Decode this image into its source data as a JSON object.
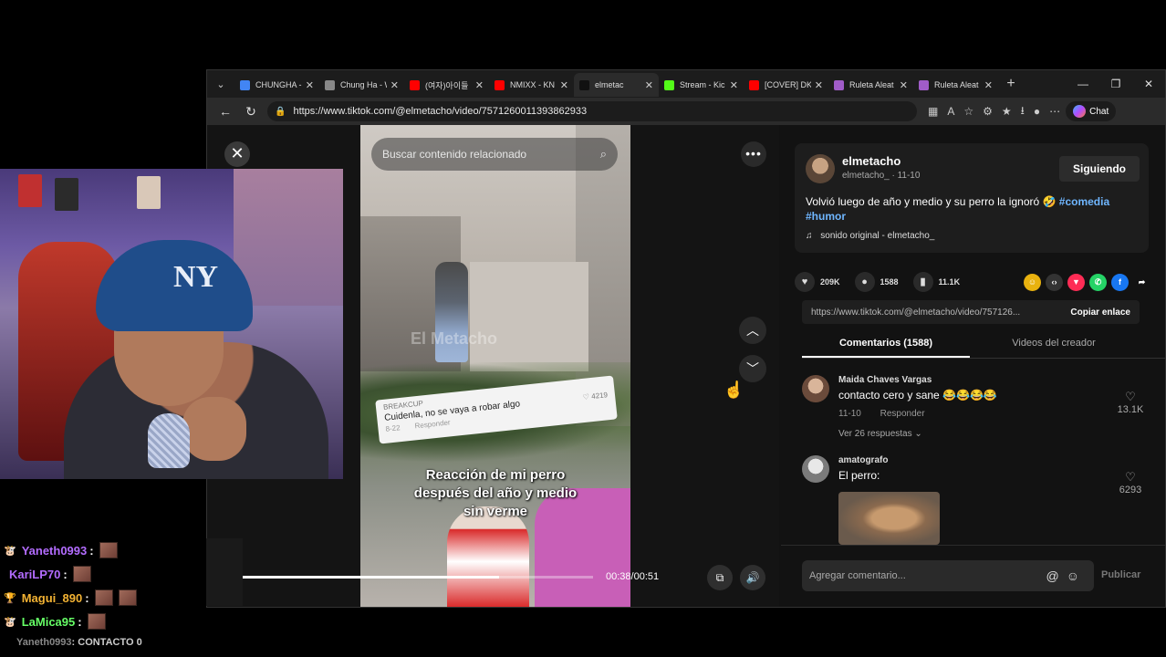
{
  "browser": {
    "tabs": [
      {
        "title": "CHUNGHA -",
        "color": "#4285f4",
        "active": false
      },
      {
        "title": "Chung Ha - W",
        "color": "#888888",
        "active": false
      },
      {
        "title": "(여자)아이들",
        "color": "#ff0000",
        "active": false
      },
      {
        "title": "NMIXX - KN",
        "color": "#ff0000",
        "active": false
      },
      {
        "title": "elmetac",
        "color": "#111111",
        "active": true
      },
      {
        "title": "Stream - Kic",
        "color": "#53fc18",
        "active": false
      },
      {
        "title": "[COVER] DK",
        "color": "#ff0000",
        "active": false
      },
      {
        "title": "Ruleta Aleat",
        "color": "#a05cc8",
        "active": false
      },
      {
        "title": "Ruleta Aleat",
        "color": "#a05cc8",
        "active": false
      }
    ],
    "url": "https://www.tiktok.com/@elmetacho/video/7571260011393862933",
    "chat_label": "Chat"
  },
  "video": {
    "search_placeholder": "Buscar contenido relacionado",
    "watermark": "El Metacho",
    "reply_card": {
      "user": "BREAKCUP",
      "text": "Cuidenla, no se vaya a robar algo",
      "date": "8-22",
      "reply": "Responder",
      "likes": "4219"
    },
    "caption_line1": "Reacción de mi perro",
    "caption_line2": "después del año y medio",
    "caption_line3": "sin verme",
    "time": "00:38/00:51",
    "progress": 0.745
  },
  "post": {
    "author": "elmetacho",
    "author_sub": "elmetacho_ · 11-10",
    "follow_label": "Siguiendo",
    "description": "Volvió luego de año y medio y su perro la ignoró 🤣",
    "tag1": "#comedia",
    "tag2": "#humor",
    "sound": "sonido original - elmetacho_",
    "likes": "209K",
    "comments": "1588",
    "saves": "11.1K",
    "link": "https://www.tiktok.com/@elmetacho/video/757126...",
    "copy_label": "Copiar enlace",
    "tab_comments": "Comentarios (1588)",
    "tab_creator": "Videos del creador"
  },
  "comments": [
    {
      "user": "Maida Chaves Vargas",
      "text": "contacto cero y sane 😂😂😂😂",
      "date": "11-10",
      "reply": "Responder",
      "more": "Ver 26 respuestas ⌄",
      "likes": "13.1K"
    },
    {
      "user": "amatografo",
      "text": "El perro:",
      "likes": "6293"
    }
  ],
  "comment_box": {
    "placeholder": "Agregar comentario...",
    "publish": "Publicar"
  },
  "stream_chat": [
    {
      "user": "Yaneth0993",
      "color": "#b36cff",
      "badge": "🐮"
    },
    {
      "user": "KariLP70",
      "color": "#b36cff",
      "badge": ""
    },
    {
      "user": "Magui_890",
      "color": "#f2b233",
      "badge": "🏆"
    },
    {
      "user": "LaMica95",
      "color": "#66ff66",
      "badge": "🐮"
    }
  ],
  "stream_chat_last": {
    "user": "Yaneth0993",
    "message": ": CONTACTO 0"
  }
}
